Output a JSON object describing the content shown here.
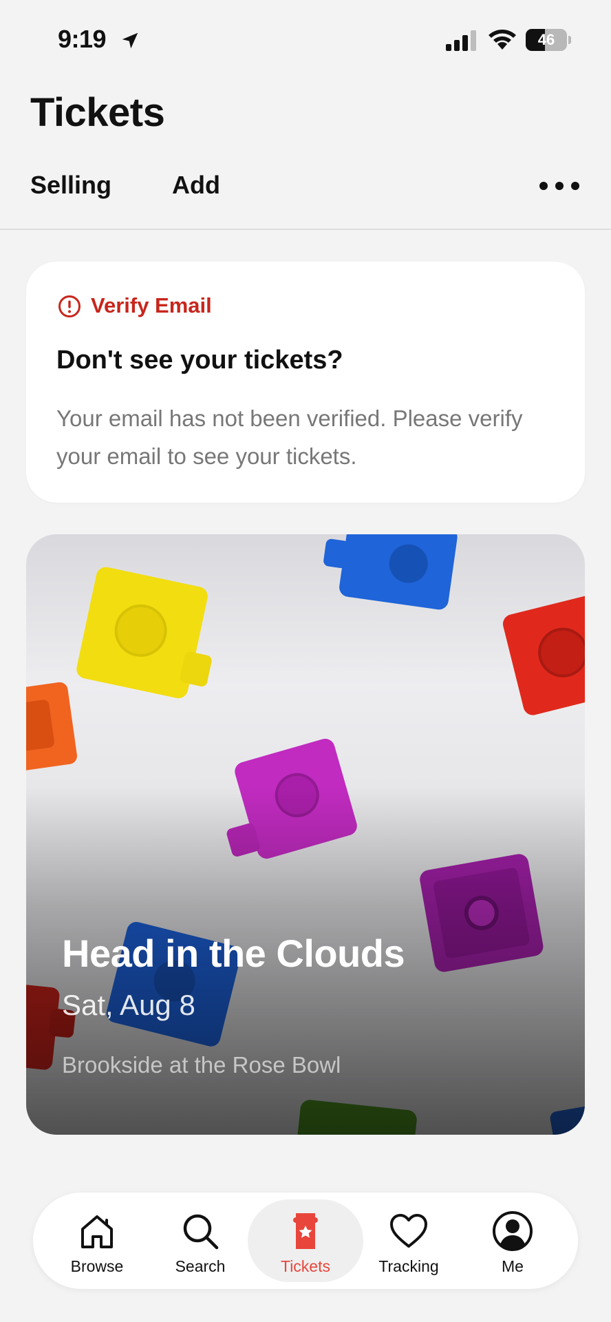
{
  "status_bar": {
    "time": "9:19",
    "battery_level": "46",
    "battery_fraction": 0.46
  },
  "header": {
    "title": "Tickets",
    "tabs": [
      {
        "label": "Selling"
      },
      {
        "label": "Add"
      }
    ],
    "more_icon": "more-horizontal-icon"
  },
  "verify_card": {
    "alert_label": "Verify Email",
    "heading": "Don't see your tickets?",
    "body": "Your email has not been verified. Please verify your email to see your tickets.",
    "accent_color": "#c7261c"
  },
  "event": {
    "title": "Head in the Clouds",
    "date": "Sat, Aug 8",
    "venue": "Brookside at the Rose Bowl"
  },
  "bottom_nav": {
    "active": "Tickets",
    "accent_color": "#e8463b",
    "items": [
      {
        "label": "Browse",
        "icon": "home-icon"
      },
      {
        "label": "Search",
        "icon": "search-icon"
      },
      {
        "label": "Tickets",
        "icon": "ticket-icon"
      },
      {
        "label": "Tracking",
        "icon": "heart-icon"
      },
      {
        "label": "Me",
        "icon": "profile-icon"
      }
    ]
  }
}
